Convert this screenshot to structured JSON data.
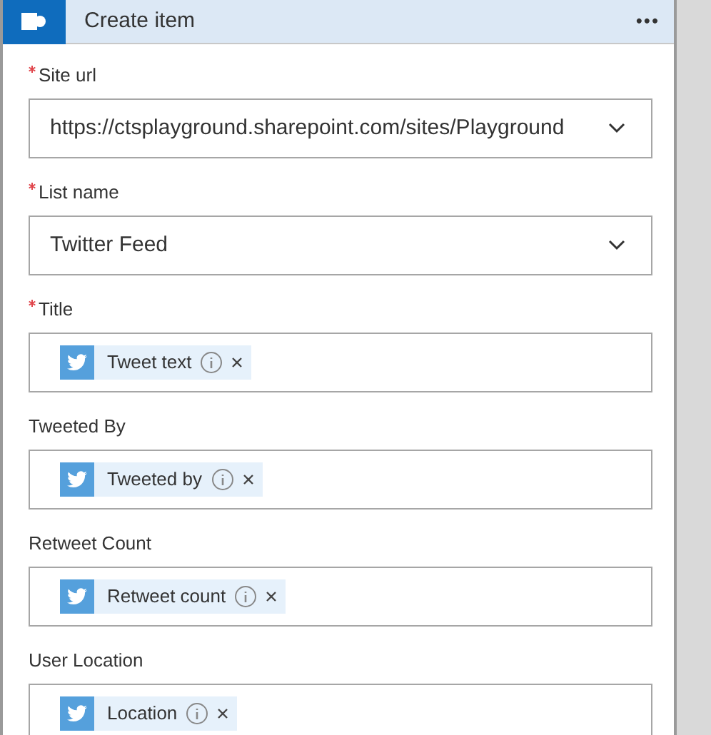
{
  "header": {
    "title": "Create item",
    "menu": "•••"
  },
  "fields": [
    {
      "label": "Site url",
      "required": true,
      "kind": "dropdown",
      "value": "https://ctsplayground.sharepoint.com/sites/Playground"
    },
    {
      "label": "List name",
      "required": true,
      "kind": "dropdown",
      "value": "Twitter Feed"
    },
    {
      "label": "Title",
      "required": true,
      "kind": "tokens",
      "tokens": [
        "Tweet text"
      ]
    },
    {
      "label": "Tweeted By",
      "required": false,
      "kind": "tokens",
      "tokens": [
        "Tweeted by"
      ]
    },
    {
      "label": "Retweet Count",
      "required": false,
      "kind": "tokens",
      "tokens": [
        "Retweet count"
      ]
    },
    {
      "label": "User Location",
      "required": false,
      "kind": "tokens",
      "tokens": [
        "Location"
      ]
    }
  ]
}
